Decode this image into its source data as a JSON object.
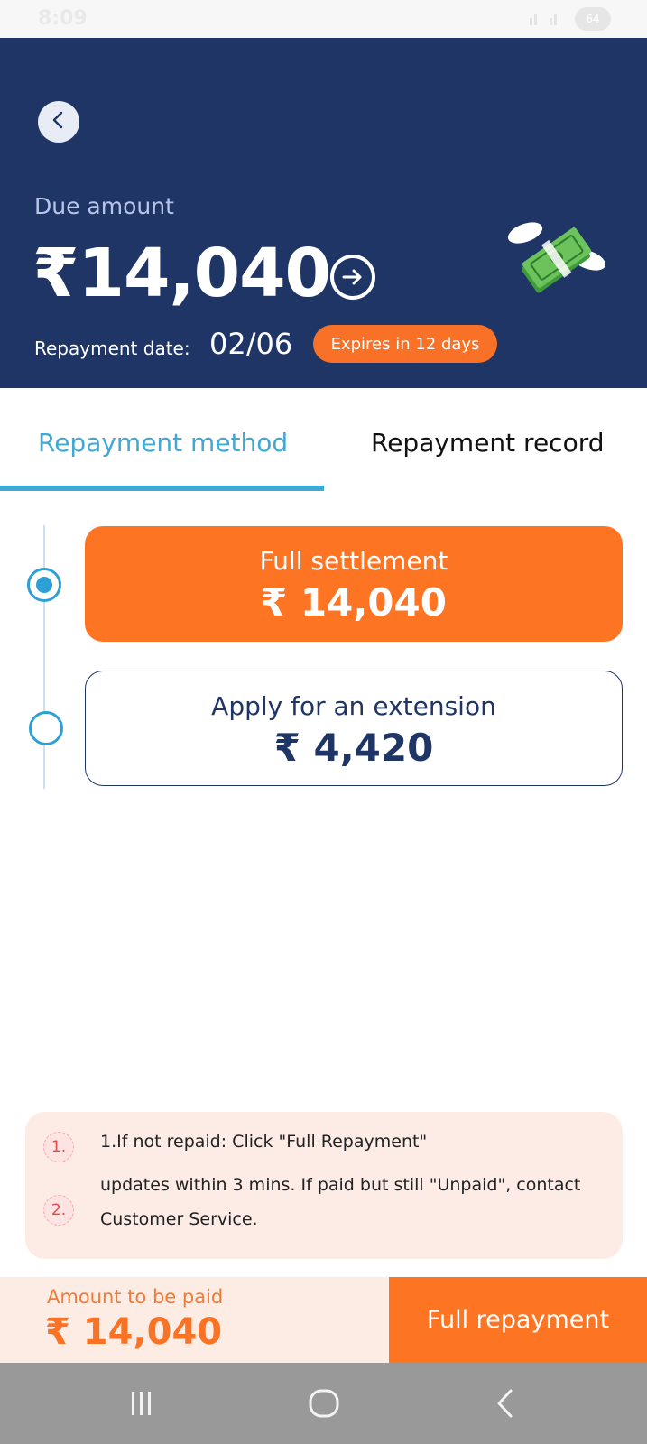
{
  "status_bar": {
    "time": "8:09",
    "battery": "64"
  },
  "header": {
    "due_label": "Due amount",
    "due_amount": "₹14,040",
    "repayment_date_label": "Repayment date:",
    "repayment_date": "02/06",
    "expires_badge": "Expires in 12 days"
  },
  "tabs": [
    {
      "label": "Repayment method",
      "active": true
    },
    {
      "label": "Repayment record",
      "active": false
    }
  ],
  "options": [
    {
      "title": "Full settlement",
      "value": "₹ 14,040",
      "selected": true
    },
    {
      "title": "Apply for an extension",
      "value": "₹ 4,420",
      "selected": false
    }
  ],
  "notes": [
    {
      "num": "1.",
      "text": "1.If not repaid: Click \"Full Repayment\""
    },
    {
      "num": "2.",
      "text": "updates within 3 mins. If paid but still \"Unpaid\", contact Customer Service."
    }
  ],
  "bottom": {
    "amount_label": "Amount to be paid",
    "amount_value": "₹ 14,040",
    "pay_button": "Full repayment"
  },
  "colors": {
    "header_bg": "#1e3566",
    "accent_orange": "#fd7423",
    "accent_blue": "#3fa9d4"
  },
  "icons": {
    "back": "chevron-left-icon",
    "arrow": "arrow-right-circle-icon",
    "money": "flying-money-icon"
  }
}
